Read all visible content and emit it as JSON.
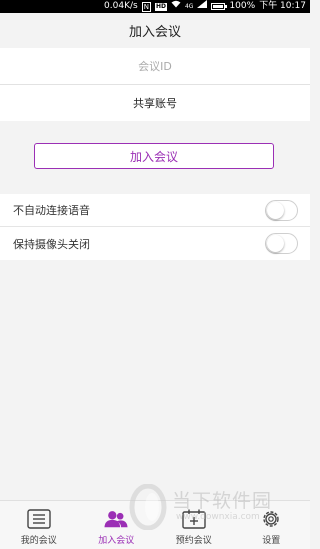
{
  "status_bar": {
    "speed": "0.04K/s",
    "nfc": "N",
    "hd": "HD",
    "network": "4G",
    "battery": "100%",
    "time": "下午 10:17"
  },
  "header": {
    "title": "加入会议"
  },
  "form": {
    "meeting_id_placeholder": "会议ID",
    "share_account_label": "共享账号",
    "join_button": "加入会议"
  },
  "options": [
    {
      "label": "不自动连接语音",
      "checked": false
    },
    {
      "label": "保持摄像头关闭",
      "checked": false
    }
  ],
  "tabs": [
    {
      "label": "我的会议",
      "icon": "list-icon",
      "active": false
    },
    {
      "label": "加入会议",
      "icon": "users-icon",
      "active": true
    },
    {
      "label": "预约会议",
      "icon": "calendar-icon",
      "active": false
    },
    {
      "label": "设置",
      "icon": "gear-icon",
      "active": false
    }
  ],
  "watermark": {
    "brand": "当下软件园",
    "url": "www.downxia.com"
  },
  "colors": {
    "accent": "#9b2fb5",
    "background": "#f3f3f3"
  }
}
